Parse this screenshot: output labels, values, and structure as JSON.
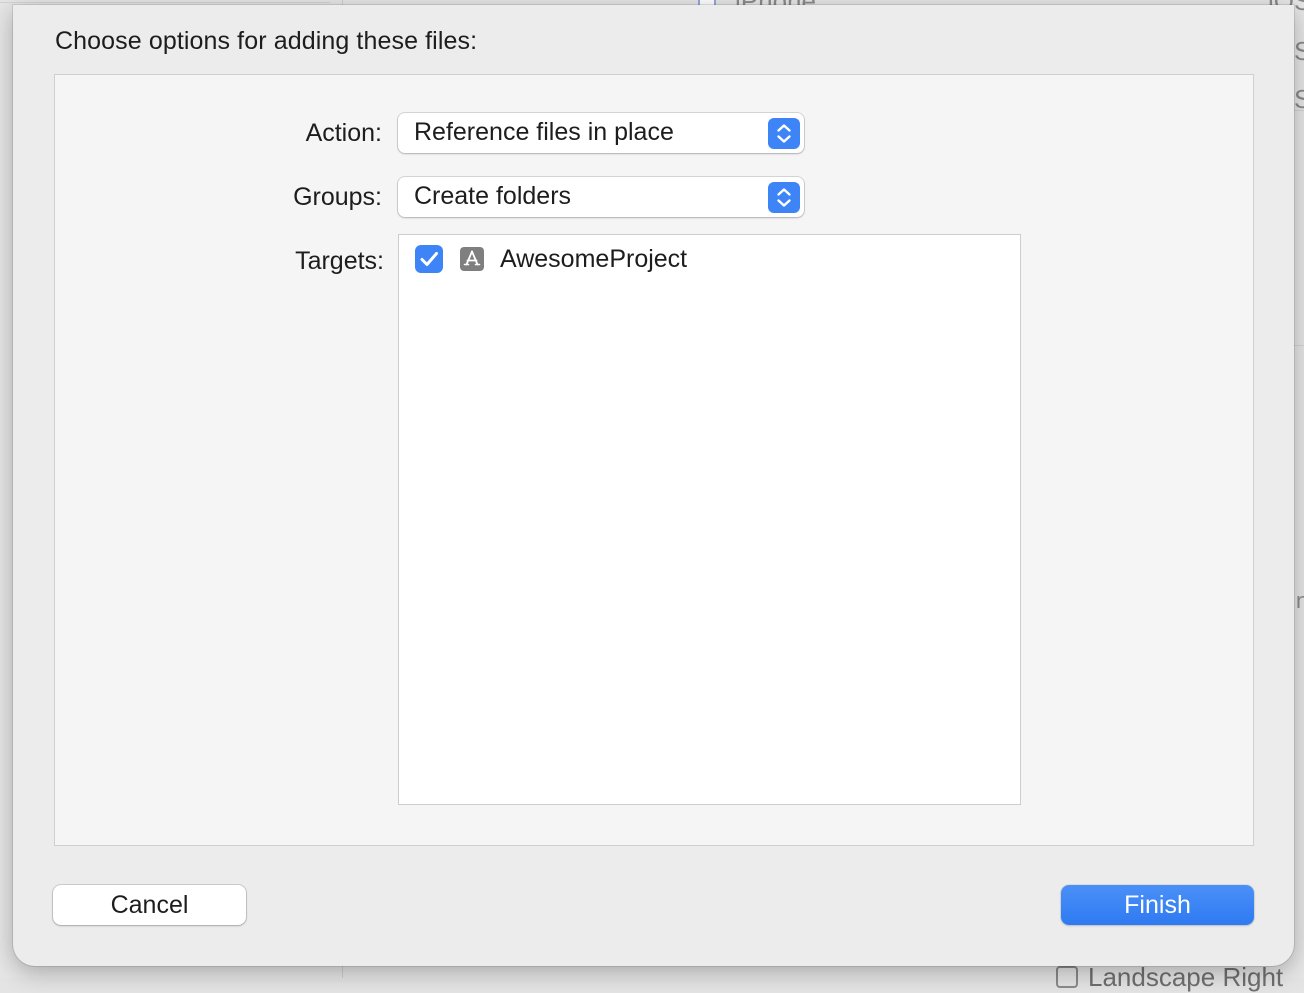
{
  "background": {
    "device_label": "iPhone",
    "right_clip_top": "iOS",
    "right_clip_s1": "S",
    "right_clip_s2": "S",
    "right_clip_m": "n",
    "bottom_label": "Landscape Right"
  },
  "sheet": {
    "title": "Choose options for adding these files:",
    "action": {
      "label": "Action:",
      "value": "Reference files in place"
    },
    "groups": {
      "label": "Groups:",
      "value": "Create folders"
    },
    "targets": {
      "label": "Targets:",
      "items": [
        {
          "name": "AwesomeProject",
          "checked": true,
          "icon": "app-target-icon"
        }
      ]
    },
    "buttons": {
      "cancel": "Cancel",
      "finish": "Finish"
    }
  },
  "colors": {
    "accent": "#3d85f6",
    "sheet_bg": "#ececec",
    "panel_bg": "#f5f5f5"
  }
}
